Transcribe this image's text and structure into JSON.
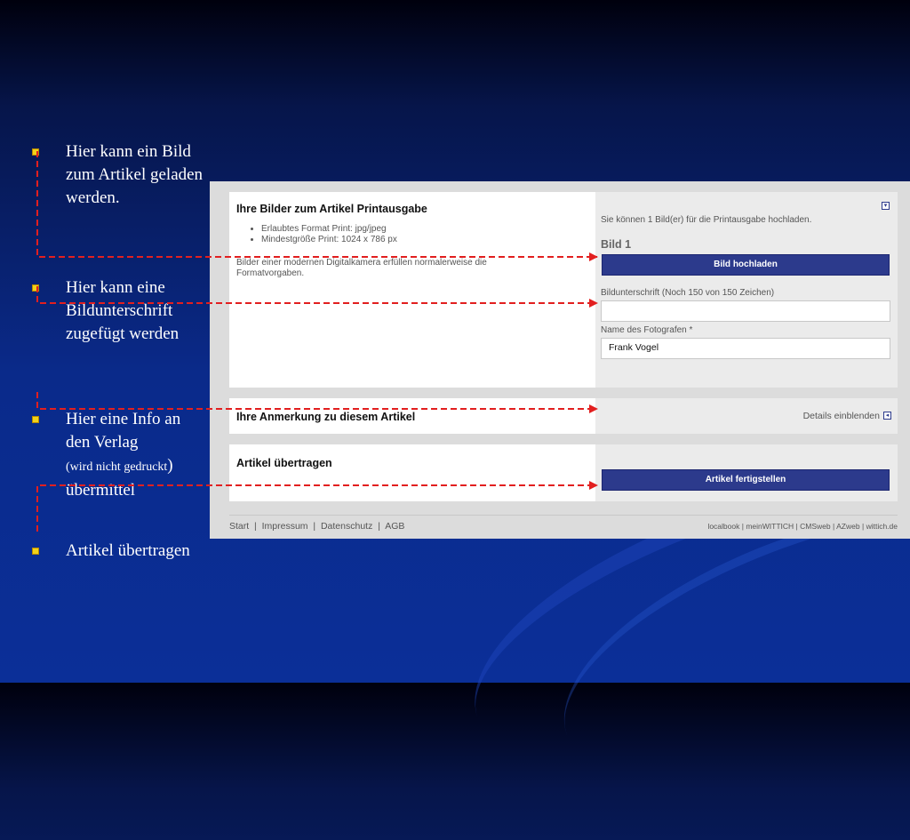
{
  "slide": {
    "bullets": [
      {
        "text": "Hier kann ein Bild zum Artikel geladen werden."
      },
      {
        "text": "Hier kann eine Bildunterschrift zugefügt werden"
      },
      {
        "line1": "Hier eine Info an den Verlag",
        "line2": "(wird nicht gedruckt",
        "line3": ")",
        "line4": "übermittel"
      },
      {
        "text": "Artikel übertragen"
      }
    ]
  },
  "screenshot": {
    "images_section": {
      "title": "Ihre Bilder zum Artikel Printausgabe",
      "requirements": [
        "Erlaubtes Format Print: jpg/jpeg",
        "Mindestgröße Print: 1024 x 786 px"
      ],
      "note": "Bilder einer modernen Digitalkamera erfüllen normalerweise die Formatvorgaben.",
      "info": "Sie können 1 Bild(er) für die Printausgabe hochladen.",
      "image_label": "Bild 1",
      "upload_button": "Bild hochladen",
      "caption_label": "Bildunterschrift (Noch 150 von 150 Zeichen)",
      "caption_value": "",
      "photographer_label": "Name des Fotografen *",
      "photographer_value": "Frank Vogel",
      "collapse_icon": "chevron-down-icon"
    },
    "note_section": {
      "title": "Ihre Anmerkung zu diesem Artikel",
      "toggle_label": "Details einblenden",
      "toggle_icon": "chevron-left-icon"
    },
    "submit_section": {
      "title": "Artikel übertragen",
      "submit_button": "Artikel fertigstellen"
    },
    "footer": {
      "links": [
        "Start",
        "Impressum",
        "Datenschutz",
        "AGB"
      ],
      "separator": "|",
      "partner_links": [
        "localbook",
        "meinWITTICH",
        "CMSweb",
        "AZweb",
        "wittich.de"
      ]
    }
  },
  "colors": {
    "accent_button": "#2c3a8c",
    "bullet": "#f2d21a",
    "arrow": "#e21f1f"
  }
}
